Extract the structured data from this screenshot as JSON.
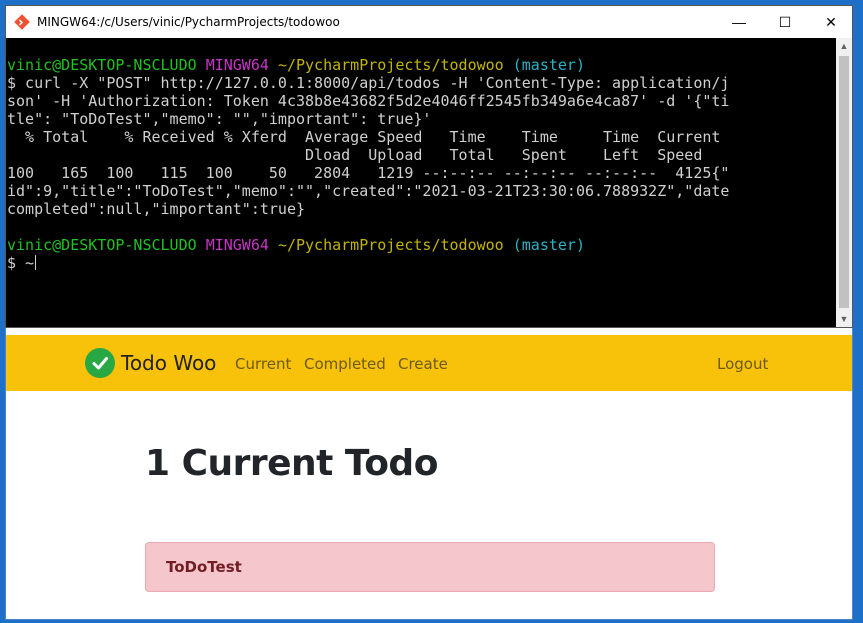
{
  "terminal": {
    "title": "MINGW64:/c/Users/vinic/PycharmProjects/todowoo",
    "minimize_glyph": "—",
    "maximize_glyph": "☐",
    "close_glyph": "✕",
    "prompt1": {
      "user": "vinic@DESKTOP-NSCLUDO",
      "shell": "MINGW64",
      "path": "~/PycharmProjects/todowoo",
      "branch": "(master)"
    },
    "lines": [
      "$ curl -X \"POST\" http://127.0.0.1:8000/api/todos -H 'Content-Type: application/j",
      "son' -H 'Authorization: Token 4c38b8e43682f5d2e4046ff2545fb349a6e4ca87' -d '{\"ti",
      "tle\": \"ToDoTest\",\"memo\": \"\",\"important\": true}'",
      "  % Total    % Received % Xferd  Average Speed   Time    Time     Time  Current",
      "                                 Dload  Upload   Total   Spent    Left  Speed",
      "100   165  100   115  100    50   2804   1219 --:--:-- --:--:-- --:--:--  4125{\"",
      "id\":9,\"title\":\"ToDoTest\",\"memo\":\"\",\"created\":\"2021-03-21T23:30:06.788932Z\",\"date",
      "completed\":null,\"important\":true}"
    ],
    "prompt2": {
      "user": "vinic@DESKTOP-NSCLUDO",
      "shell": "MINGW64",
      "path": "~/PycharmProjects/todowoo",
      "branch": "(master)"
    },
    "input_line": "$ ~"
  },
  "app": {
    "brand": "Todo Woo",
    "nav": {
      "current": "Current",
      "completed": "Completed",
      "create": "Create",
      "logout": "Logout"
    },
    "heading": "1 Current Todo",
    "todos": [
      {
        "title": "ToDoTest"
      }
    ]
  },
  "colors": {
    "navbar": "#f8c20a",
    "check": "#28a745",
    "todo_important_bg": "#f5c6cb",
    "todo_important_text": "#721c24"
  }
}
